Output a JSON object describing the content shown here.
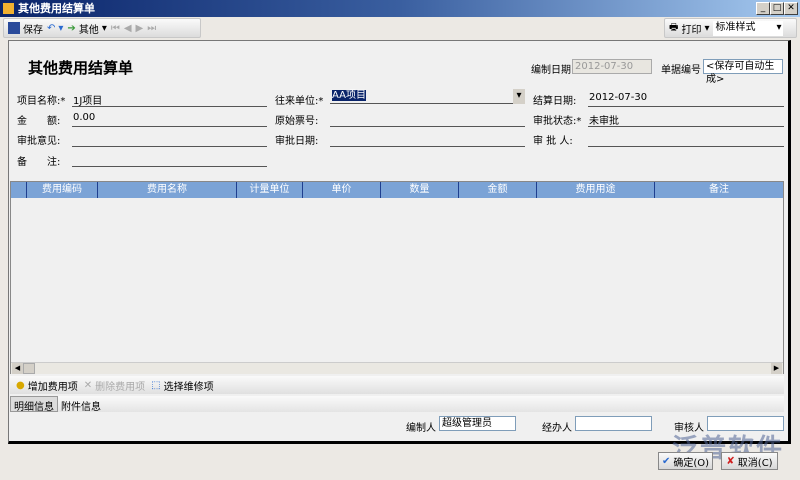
{
  "window": {
    "title": "其他费用结算单"
  },
  "toolbar": {
    "save": "保存",
    "other": "其他",
    "print": "打印",
    "style_value": "标准样式"
  },
  "form": {
    "title": "其他费用结算单",
    "date_label": "编制日期",
    "date_value": "2012-07-30",
    "docno_label": "单据编号",
    "docno_value": "<保存可自动生成>",
    "project_label": "项目名称:*",
    "project_value": "1J项目",
    "partner_label": "往来单位:*",
    "partner_value": "AA项目",
    "settle_date_label": "结算日期:",
    "settle_date_value": "2012-07-30",
    "amount_label": "金　　额:",
    "amount_value": "0.00",
    "invoice_label": "原始票号:",
    "status_label": "审批状态:*",
    "status_value": "未审批",
    "opinion_label": "审批意见:",
    "approve_date_label": "审批日期:",
    "approver_label": "审 批 人:",
    "remark_label": "备　　注:"
  },
  "grid": {
    "columns": [
      "费用编码",
      "费用名称",
      "计量单位",
      "单价",
      "数量",
      "金额",
      "费用用途",
      "备注"
    ]
  },
  "detail_toolbar": {
    "add": "增加费用项",
    "delete": "删除费用项",
    "select": "选择维修项"
  },
  "tabs": [
    "明细信息",
    "附件信息"
  ],
  "footer": {
    "maker_label": "编制人",
    "maker_value": "超级管理员",
    "handler_label": "经办人",
    "handler_value": "",
    "auditor_label": "审核人",
    "auditor_value": ""
  },
  "buttons": {
    "ok": "确定(O)",
    "cancel": "取消(C)"
  },
  "watermark": "泛普软件"
}
